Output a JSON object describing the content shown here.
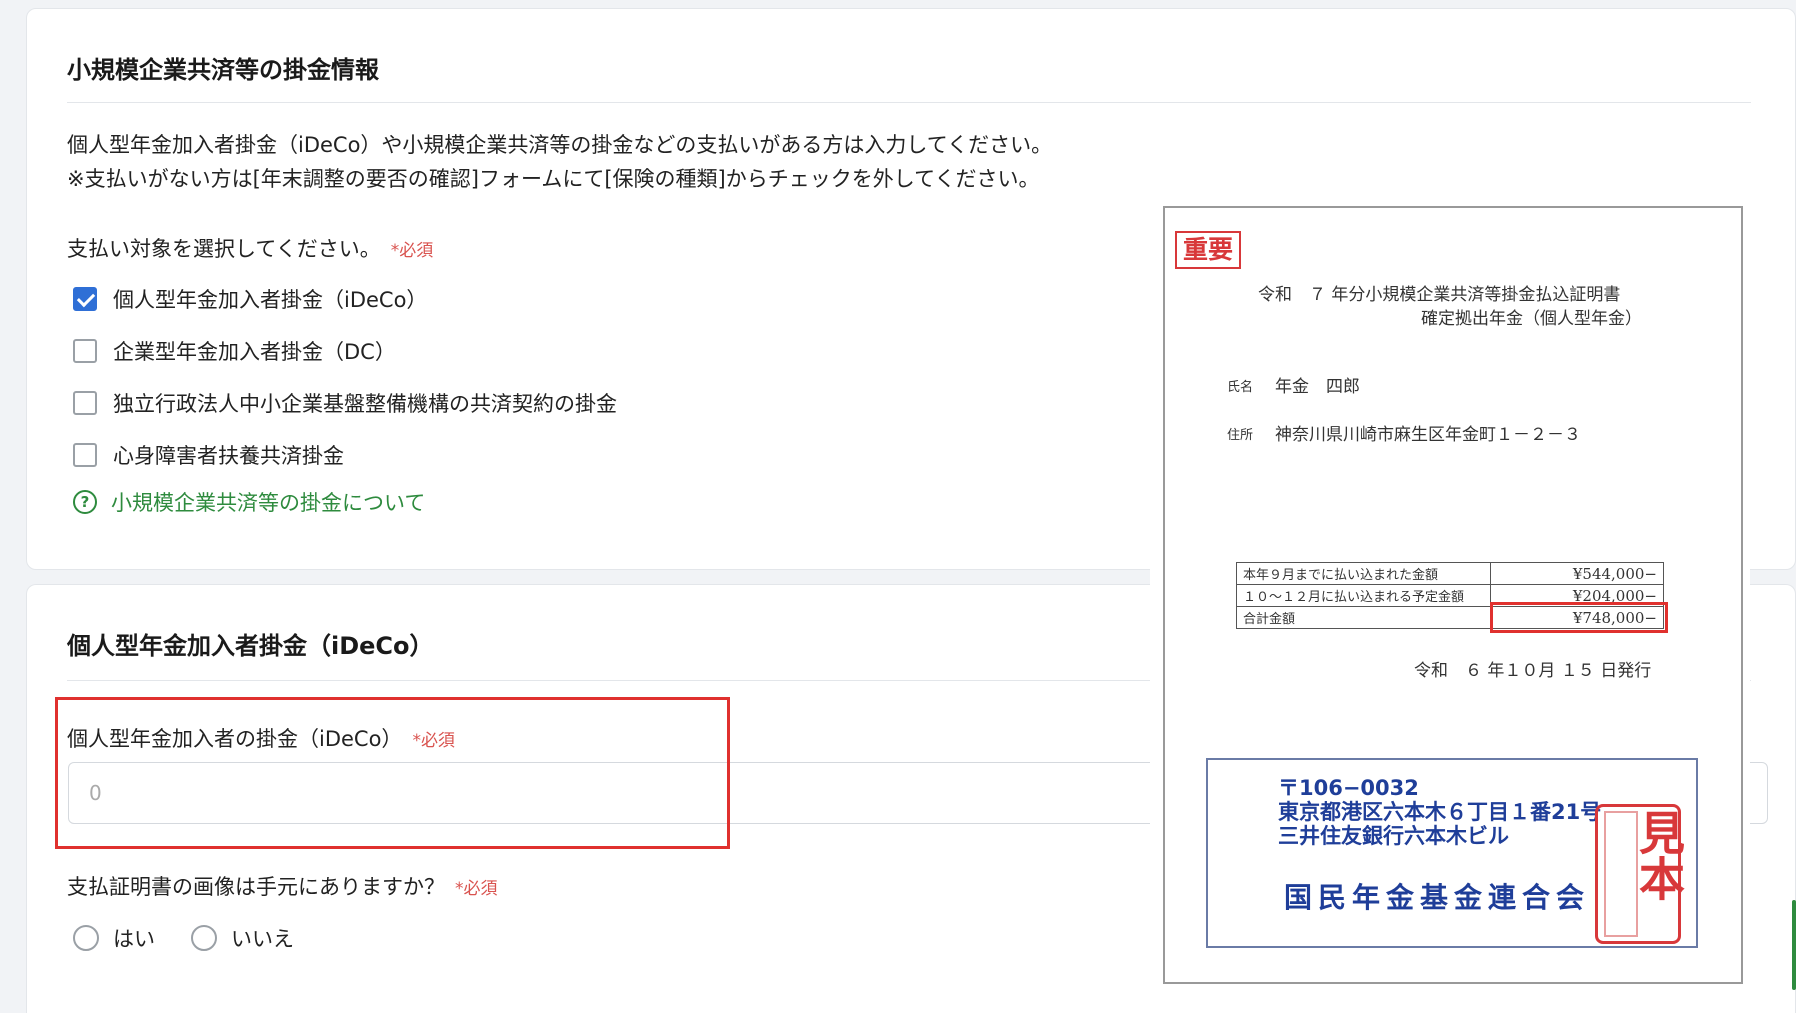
{
  "section1": {
    "title": "小規模企業共済等の掛金情報",
    "desc_line1": "個人型年金加入者掛金（iDeCo）や小規模企業共済等の掛金などの支払いがある方は入力してください。",
    "desc_line2": "※支払いがない方は[年末調整の要否の確認]フォームにて[保険の種類]からチェックを外してください。",
    "select_label": "支払い対象を選択してください。",
    "required": "*必須",
    "options": [
      {
        "label": "個人型年金加入者掛金（iDeCo）",
        "checked": true
      },
      {
        "label": "企業型年金加入者掛金（DC）",
        "checked": false
      },
      {
        "label": "独立行政法人中小企業基盤整備機構の共済契約の掛金",
        "checked": false
      },
      {
        "label": "心身障害者扶養共済掛金",
        "checked": false
      }
    ],
    "help_link": "小規模企業共済等の掛金について"
  },
  "section2": {
    "title": "個人型年金加入者掛金（iDeCo）",
    "field_label": "個人型年金加入者の掛金（iDeCo）",
    "required": "*必須",
    "field_placeholder": "0",
    "image_question": "支払証明書の画像は手元にありますか？",
    "radio_yes": "はい",
    "radio_no": "いいえ"
  },
  "document": {
    "important_stamp": "重要",
    "title_line1": "令和　７ 年分小規模企業共済等掛金払込証明書",
    "title_line2": "確定拠出年金（個人型年金）",
    "name_label": "氏名",
    "name_value": "年金　四郎",
    "address_label": "住所",
    "address_value": "神奈川県川崎市麻生区年金町１－２－３",
    "rows": [
      {
        "label": "本年９月までに払い込まれた金額",
        "amount": "¥544,000−"
      },
      {
        "label": "１０～１２月に払い込まれる予定金額",
        "amount": "¥204,000−"
      },
      {
        "label": "合計金額",
        "amount": "¥748,000−"
      }
    ],
    "issued": "令和　６ 年１０月 １５ 日発行",
    "postal": "〒106−0032",
    "addr1": "東京都港区六本木６丁目１番21号",
    "addr2": "三井住友銀行六本木ビル",
    "org": "国民年金基金連合会",
    "sample_stamp": "見本"
  },
  "colors": {
    "accent_blue": "#2f6fd6",
    "required_red": "#d9534f",
    "link_green": "#2e8b3e",
    "highlight_red": "#e0312e",
    "doc_blue": "#1f3e99"
  }
}
